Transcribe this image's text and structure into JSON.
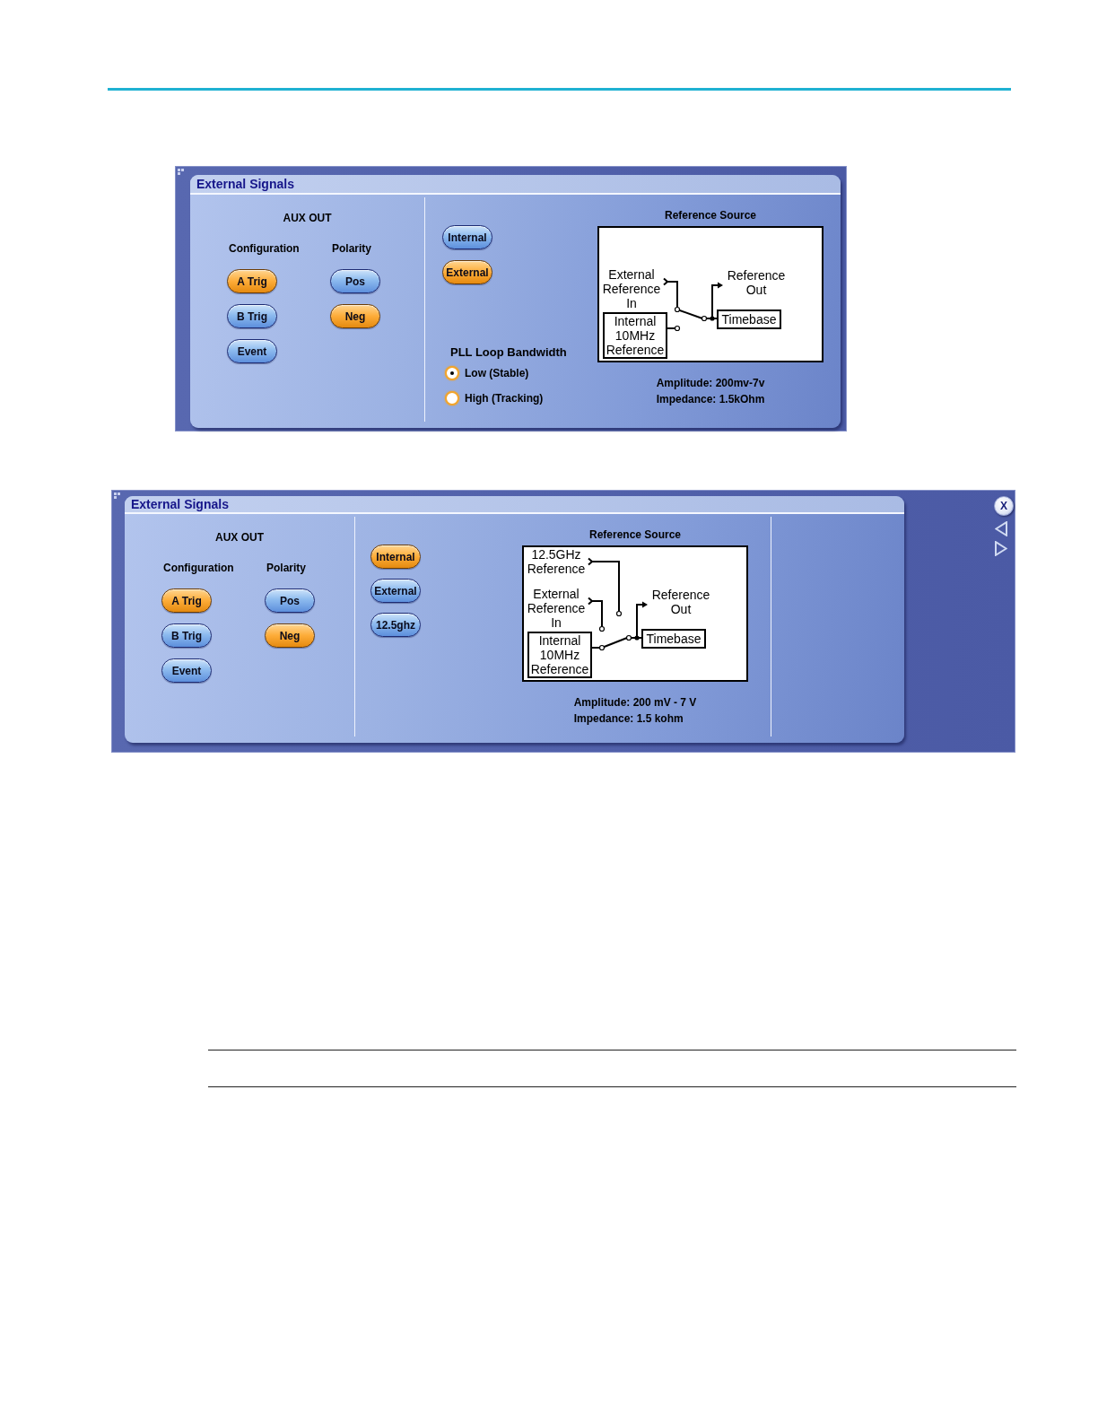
{
  "dialogs": [
    {
      "kind": "compact",
      "title": "External Signals",
      "aux_out": {
        "heading": "AUX OUT",
        "groups": [
          {
            "label": "Configuration",
            "buttons": [
              {
                "label": "A Trig",
                "selected": true
              },
              {
                "label": "B Trig",
                "selected": false
              },
              {
                "label": "Event",
                "selected": false
              }
            ]
          },
          {
            "label": "Polarity",
            "buttons": [
              {
                "label": "Pos",
                "selected": false
              },
              {
                "label": "Neg",
                "selected": true
              }
            ]
          }
        ]
      },
      "reference_buttons": [
        {
          "label": "Internal",
          "selected": false
        },
        {
          "label": "External",
          "selected": true
        }
      ],
      "pll_loop_bandwidth": {
        "label": "PLL Loop Bandwidth",
        "options": [
          {
            "label": "Low (Stable)",
            "selected": true
          },
          {
            "label": "High (Tracking)",
            "selected": false
          }
        ]
      },
      "reference_source": {
        "title": "Reference Source",
        "diagram": {
          "inputs": [
            {
              "kind": "terminal",
              "label": "External Reference In",
              "connected": true
            },
            {
              "kind": "box",
              "label": "Internal 10MHz Reference",
              "connected": false
            }
          ],
          "output": "Reference Out",
          "timebase": "Timebase"
        },
        "specs": [
          "Amplitude: 200mv-7v",
          "Impedance: 1.5kOhm"
        ]
      }
    },
    {
      "kind": "wide",
      "title": "External Signals",
      "aux_out": {
        "heading": "AUX OUT",
        "groups": [
          {
            "label": "Configuration",
            "buttons": [
              {
                "label": "A Trig",
                "selected": true
              },
              {
                "label": "B Trig",
                "selected": false
              },
              {
                "label": "Event",
                "selected": false
              }
            ]
          },
          {
            "label": "Polarity",
            "buttons": [
              {
                "label": "Pos",
                "selected": false
              },
              {
                "label": "Neg",
                "selected": true
              }
            ]
          }
        ]
      },
      "reference_buttons": [
        {
          "label": "Internal",
          "selected": true
        },
        {
          "label": "External",
          "selected": false
        },
        {
          "label": "12.5ghz",
          "selected": false
        }
      ],
      "reference_source": {
        "title": "Reference Source",
        "diagram": {
          "inputs": [
            {
              "kind": "terminal",
              "label": "12.5GHz Reference",
              "connected": false
            },
            {
              "kind": "terminal",
              "label": "External Reference In",
              "connected": false
            },
            {
              "kind": "box",
              "label": "Internal 10MHz Reference",
              "connected": true
            }
          ],
          "output": "Reference Out",
          "timebase": "Timebase"
        },
        "specs": [
          "Amplitude: 200 mV - 7 V",
          "Impedance: 1.5 kohm"
        ]
      },
      "close_label": "X"
    }
  ]
}
